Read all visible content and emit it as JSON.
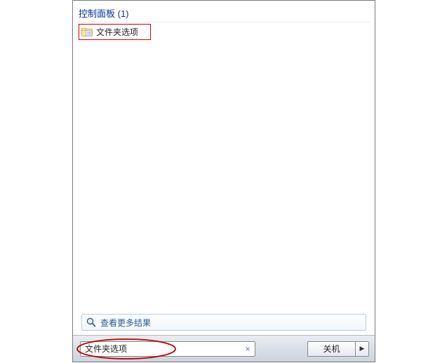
{
  "group": {
    "header": "控制面板 (1)",
    "items": [
      {
        "icon": "folder-options-icon",
        "label": "文件夹选项"
      }
    ]
  },
  "see_more": {
    "label": "查看更多结果"
  },
  "search": {
    "value": "文件夹选项",
    "clear_glyph": "×"
  },
  "shutdown": {
    "label": "关机",
    "arrow_glyph": "▶"
  }
}
